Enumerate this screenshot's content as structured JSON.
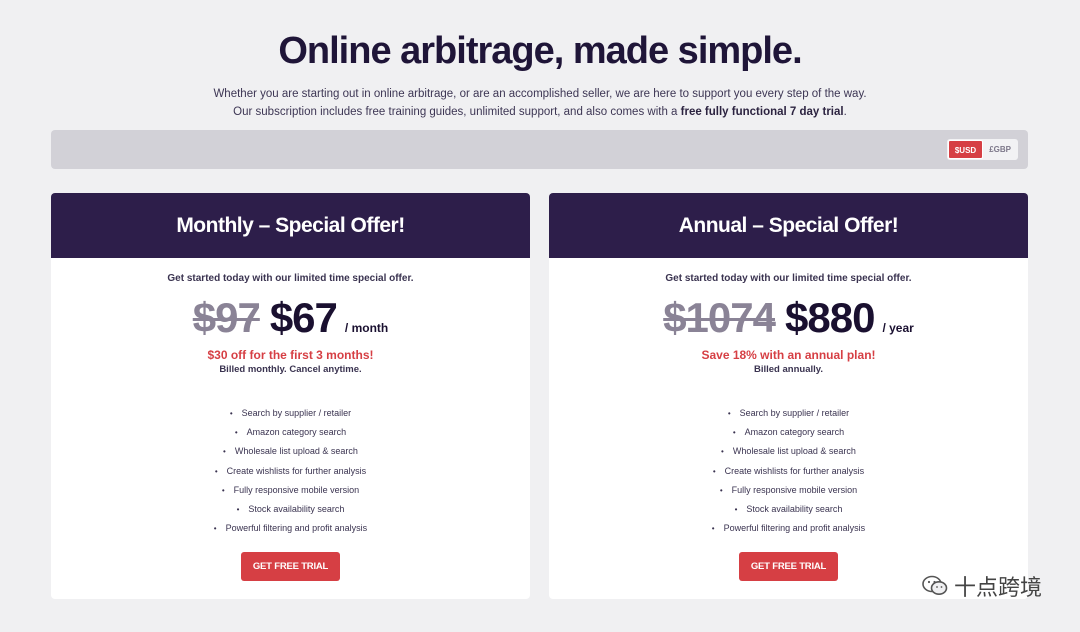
{
  "hero": {
    "title": "Online arbitrage, made simple.",
    "line1": "Whether you are starting out in online arbitrage, or are an accomplished seller, we are here to support you every step of the way.",
    "line2_prefix": "Our subscription includes free training guides, unlimited support, and also comes with a ",
    "line2_bold": "free fully functional 7 day trial",
    "line2_suffix": "."
  },
  "currency": {
    "options": [
      "$USD",
      "£GBP"
    ],
    "selected": "$USD"
  },
  "plans": [
    {
      "title": "Monthly – Special Offer!",
      "intro": "Get started today with our limited time special offer.",
      "old_price": "$97",
      "new_price": "$67",
      "period": "/ month",
      "offer": "$30 off for the first 3 months!",
      "billing": "Billed monthly. Cancel anytime.",
      "features": [
        "Search by supplier / retailer",
        "Amazon category search",
        "Wholesale list upload & search",
        "Create wishlists for further analysis",
        "Fully responsive mobile version",
        "Stock availability search",
        "Powerful filtering and profit analysis"
      ],
      "cta": "GET FREE TRIAL"
    },
    {
      "title": "Annual – Special Offer!",
      "intro": "Get started today with our limited time special offer.",
      "old_price": "$1074",
      "new_price": "$880",
      "period": "/ year",
      "offer": "Save 18% with an annual plan!",
      "billing": "Billed annually.",
      "features": [
        "Search by supplier / retailer",
        "Amazon category search",
        "Wholesale list upload & search",
        "Create wishlists for further analysis",
        "Fully responsive mobile version",
        "Stock availability search",
        "Powerful filtering and profit analysis"
      ],
      "cta": "GET FREE TRIAL"
    }
  ],
  "watermark": {
    "text": "十点跨境",
    "icon": "wechat-icon"
  },
  "colors": {
    "brand_dark": "#2d1e4a",
    "accent_red": "#d63f44",
    "background": "#f0f0f2"
  }
}
